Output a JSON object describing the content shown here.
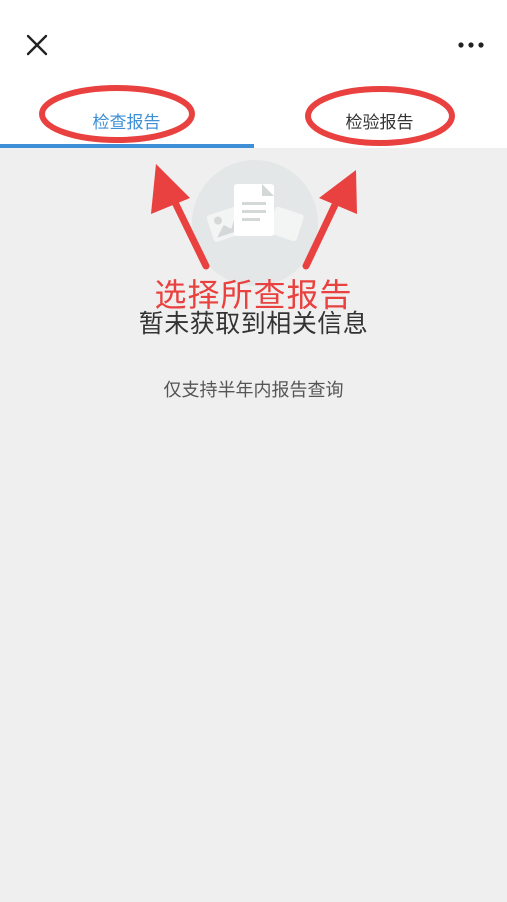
{
  "header": {
    "close_icon": "close-icon",
    "more_icon": "more-icon"
  },
  "tabs": [
    {
      "label": "检查报告",
      "active": true
    },
    {
      "label": "检验报告",
      "active": false
    }
  ],
  "empty_state": {
    "icon": "document-image-icon",
    "title": "暂未获取到相关信息",
    "subtitle": "仅支持半年内报告查询"
  },
  "annotation": {
    "text": "选择所查报告",
    "color": "#e9413f"
  },
  "colors": {
    "accent": "#3f8fd6",
    "background": "#efefef"
  }
}
